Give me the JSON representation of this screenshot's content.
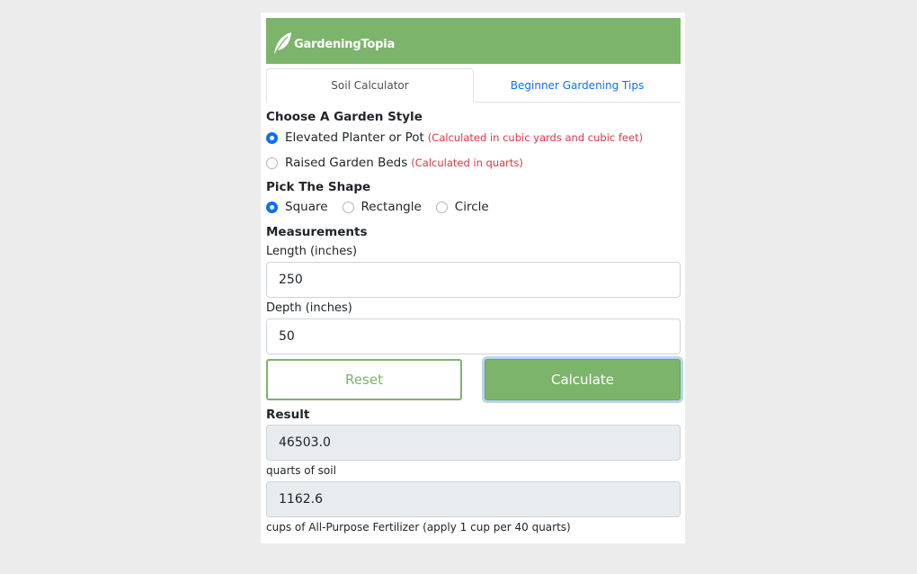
{
  "brand": {
    "name": "GardeningTopia",
    "icon": "leaf-icon",
    "color": "#7cb46b"
  },
  "tabs": [
    {
      "label": "Soil Calculator",
      "active": true
    },
    {
      "label": "Beginner Gardening Tips",
      "active": false
    }
  ],
  "garden_style": {
    "heading": "Choose A Garden Style",
    "options": [
      {
        "label": "Elevated Planter or Pot",
        "note": "(Calculated in cubic yards and cubic feet)",
        "checked": true
      },
      {
        "label": "Raised Garden Beds",
        "note": "(Calculated in quarts)",
        "checked": false
      }
    ]
  },
  "shape": {
    "heading": "Pick The Shape",
    "options": [
      {
        "label": "Square",
        "checked": true
      },
      {
        "label": "Rectangle",
        "checked": false
      },
      {
        "label": "Circle",
        "checked": false
      }
    ]
  },
  "measurements": {
    "heading": "Measurements",
    "length_label": "Length (inches)",
    "length_value": "250",
    "depth_label": "Depth (inches)",
    "depth_value": "50"
  },
  "buttons": {
    "reset": "Reset",
    "calculate": "Calculate"
  },
  "result": {
    "heading": "Result",
    "soil_value": "46503.0",
    "soil_caption": "quarts of soil",
    "fertilizer_value": "1162.6",
    "fertilizer_caption": "cups of All-Purpose Fertilizer (apply 1 cup per 40 quarts)"
  }
}
